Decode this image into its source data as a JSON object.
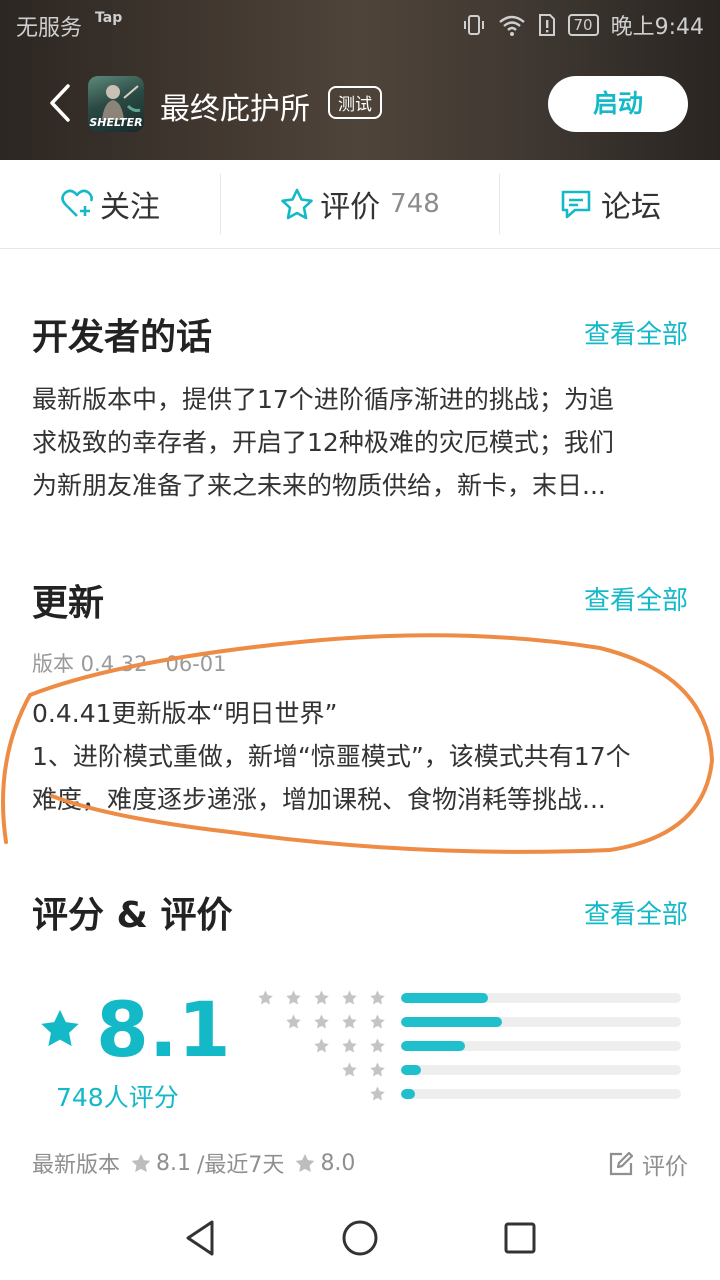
{
  "status_bar": {
    "carrier": "无服务",
    "tap": "Tap",
    "battery": "70",
    "time": "晚上9:44"
  },
  "app": {
    "icon_label": "SHELTER",
    "name": "最终庇护所",
    "badge": "测试",
    "launch_label": "启动"
  },
  "tabs": {
    "follow": "关注",
    "review": "评价",
    "review_count": "748",
    "forum": "论坛"
  },
  "developer": {
    "title": "开发者的话",
    "more": "查看全部",
    "lines": [
      "最新版本中，提供了17个进阶循序渐进的挑战；为追",
      "求极致的幸存者，开启了12种极难的灾厄模式；我们",
      "为新朋友准备了来之未来的物质供给，新卡，末日..."
    ]
  },
  "update": {
    "title": "更新",
    "more": "查看全部",
    "version": "版本 0.4.32",
    "date": "06-01",
    "lines": [
      "0.4.41更新版本“明日世界”",
      "1、进阶模式重做，新增“惊噩模式”，该模式共有17个",
      "难度，难度逐步递涨，增加课税、食物消耗等挑战..."
    ]
  },
  "ratings": {
    "title": "评分 & 评价",
    "more": "查看全部",
    "score": "8.1",
    "count_text": "748人评分",
    "distribution": [
      {
        "stars": 5,
        "fraction": 0.31
      },
      {
        "stars": 4,
        "fraction": 0.36
      },
      {
        "stars": 3,
        "fraction": 0.23
      },
      {
        "stars": 2,
        "fraction": 0.07
      },
      {
        "stars": 1,
        "fraction": 0.05
      }
    ],
    "latest_label": "最新版本",
    "latest_score": "8.1",
    "recent_label": "/最近7天",
    "recent_score": "8.0",
    "rate_label": "评价"
  },
  "colors": {
    "accent": "#14b9c8",
    "annotation": "#ee8c45"
  }
}
